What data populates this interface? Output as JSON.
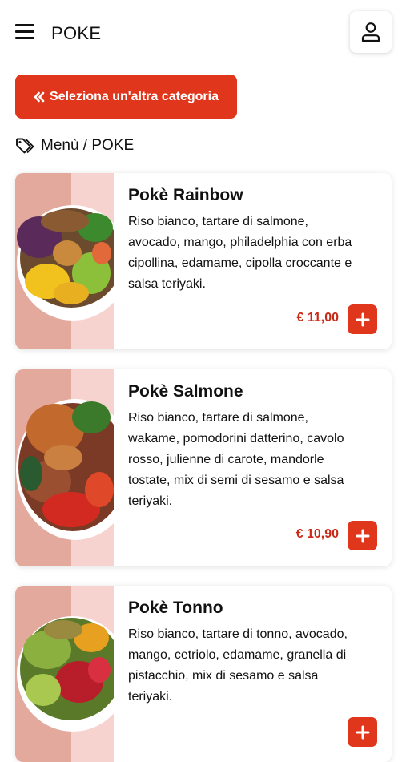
{
  "header": {
    "title": "POKE",
    "menu_icon": "hamburger-icon",
    "user_icon": "user-icon"
  },
  "back_button": {
    "label": "Seleziona un'altra categoria",
    "icon": "double-chevron-left-icon"
  },
  "breadcrumb": {
    "icon": "tags-icon",
    "text": "Menù / POKE"
  },
  "colors": {
    "accent": "#e0361c",
    "price": "#c92a17",
    "photo_bg": "#f7d3d0",
    "photo_band": "#e4a99d"
  },
  "products": [
    {
      "name": "Pokè Rainbow",
      "lines": [
        "Riso bianco, tartare di salmone,",
        "avocado, mango, philadelphia con erba",
        "cipollina, edamame, cipolla croccante e",
        "salsa teriyaki."
      ],
      "price": "€ 11,00"
    },
    {
      "name": "Pokè Salmone",
      "lines": [
        "Riso bianco, tartare di salmone,",
        "wakame, pomodorini datterino, cavolo",
        "rosso, julienne di carote, mandorle",
        "tostate, mix di semi di sesamo e salsa",
        "teriyaki."
      ],
      "price": "€ 10,90"
    },
    {
      "name": "Pokè Tonno",
      "lines": [
        "Riso bianco, tartare di tonno, avocado,",
        "mango, cetriolo, edamame, granella di",
        "pistacchio, mix di sesamo e salsa",
        "teriyaki."
      ],
      "price": ""
    }
  ]
}
